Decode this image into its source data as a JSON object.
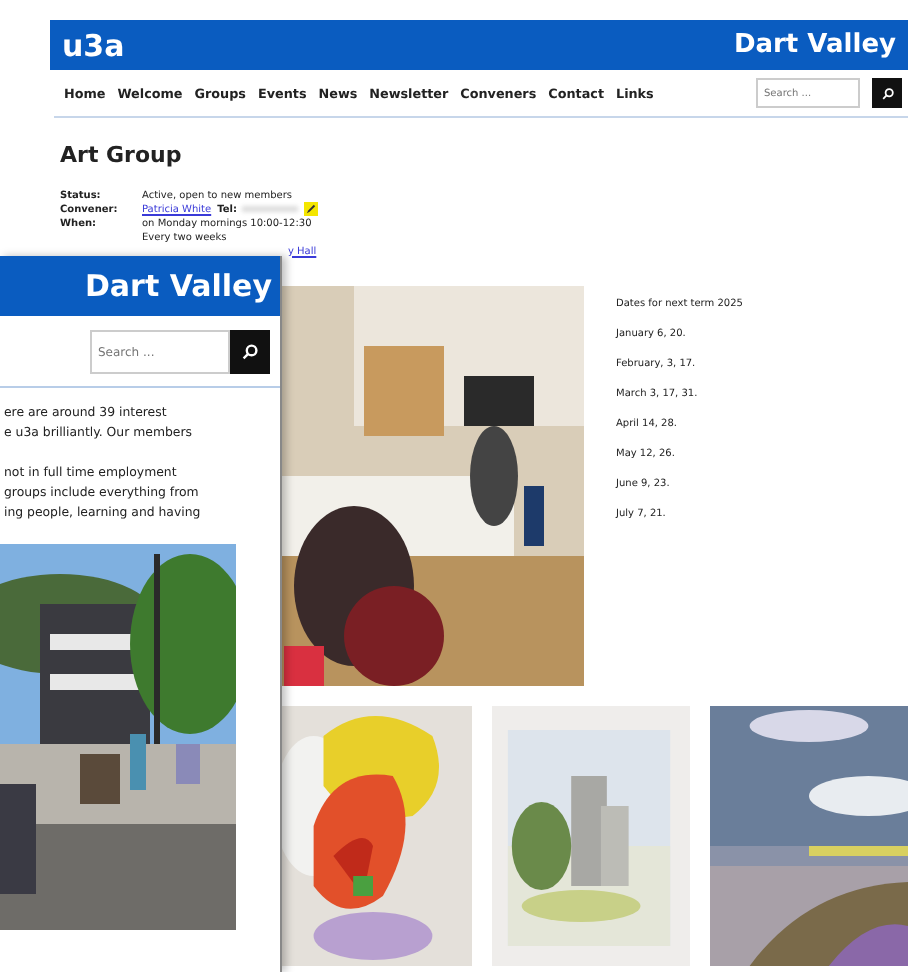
{
  "back_page": {
    "logo": "u3a",
    "site_title": "Dart Valley",
    "nav": [
      {
        "label": "Home"
      },
      {
        "label": "Welcome"
      },
      {
        "label": "Groups"
      },
      {
        "label": "Events"
      },
      {
        "label": "News"
      },
      {
        "label": "Newsletter"
      },
      {
        "label": "Conveners"
      },
      {
        "label": "Contact"
      },
      {
        "label": "Links"
      }
    ],
    "search": {
      "placeholder": "Search ..."
    },
    "heading": "Art Group",
    "details": [
      {
        "label": "Status:",
        "value": "Active, open to new members"
      },
      {
        "label": "Convener:",
        "link": "Patricia White",
        "suffix": "Tel:"
      },
      {
        "label": "When:",
        "value": "on Monday mornings 10:00-12:30"
      }
    ],
    "when_extra": "Every two weeks",
    "where_link": "y Hall",
    "photos": [
      {
        "kind": "picture"
      },
      {
        "kind": "picture"
      },
      {
        "kind": "picture"
      },
      {
        "kind": "picture"
      }
    ],
    "dates_title": "Dates for next term 2025",
    "dates": [
      "January 6, 20.",
      "February, 3, 17.",
      "March 3, 17, 31.",
      "April 14, 28.",
      "May 12, 26.",
      "June 9, 23.",
      "July 7, 21."
    ]
  },
  "front_page": {
    "site_title": "Dart Valley",
    "search": {
      "placeholder": "Search ..."
    },
    "paragraphs": [
      [
        "ere are around 39 interest",
        "e u3a brilliantly. Our members"
      ],
      [
        "not in full time employment",
        "groups include everything from",
        "ing people, learning and having"
      ]
    ],
    "photo": {
      "kind": "picture"
    }
  }
}
